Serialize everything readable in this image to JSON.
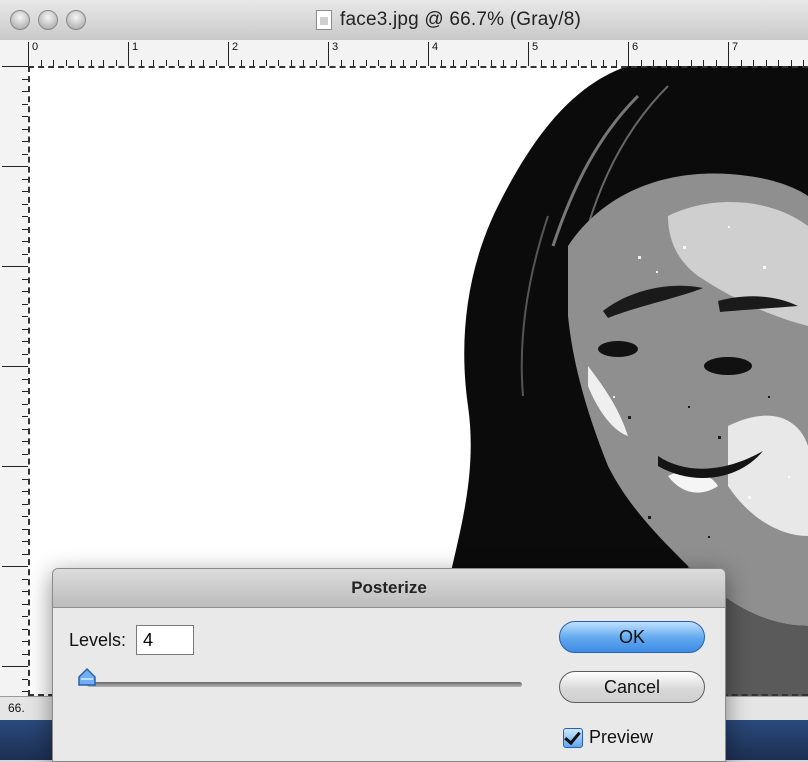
{
  "window": {
    "title": "face3.jpg @ 66.7% (Gray/8)"
  },
  "ruler": {
    "top_numbers": [
      "0",
      "1",
      "2",
      "3",
      "4",
      "5",
      "6",
      "7"
    ]
  },
  "status": {
    "zoom": "66."
  },
  "dialog": {
    "title": "Posterize",
    "levels_label": "Levels:",
    "levels_value": "4",
    "ok_label": "OK",
    "cancel_label": "Cancel",
    "preview_label": "Preview",
    "preview_checked": true,
    "levels_slider_fraction": 0.0
  },
  "colors": {
    "ok_button": "#5fa7ee",
    "dialog_bg": "#e9e9e9"
  },
  "icons": [
    "close-traffic-icon",
    "minimize-traffic-icon",
    "zoom-traffic-icon",
    "document-icon",
    "slider-thumb-icon",
    "checkbox-check-icon"
  ]
}
